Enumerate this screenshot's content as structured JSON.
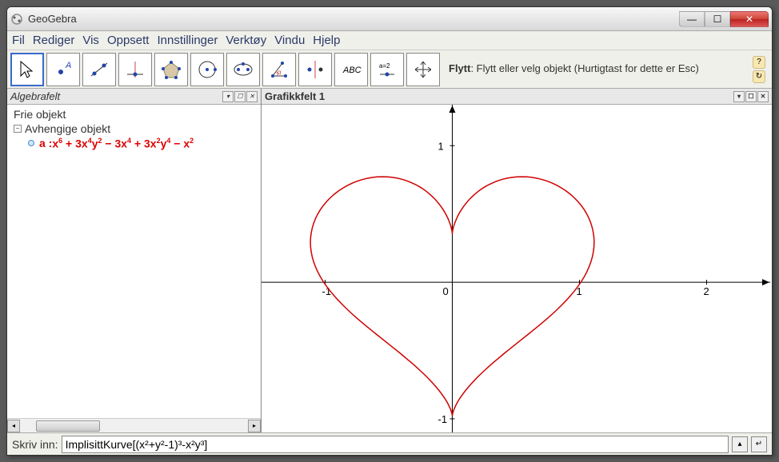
{
  "window_title": "GeoGebra",
  "menu": {
    "fil": "Fil",
    "rediger": "Rediger",
    "vis": "Vis",
    "oppsett": "Oppsett",
    "innstillinger": "Innstillinger",
    "verktoy": "Verktøy",
    "vindu": "Vindu",
    "hjelp": "Hjelp"
  },
  "toolbar_desc": {
    "title": "Flytt",
    "body": ": Flytt eller velg objekt (Hurtigtast for dette er Esc)"
  },
  "algebra": {
    "title": "Algebrafelt",
    "frie": "Frie objekt",
    "avh": "Avhengige objekt",
    "formula_prefix": "a : ",
    "formula_html": "x<sup>6</sup> + 3x<sup>4</sup>y<sup>2</sup> − 3x<sup>4</sup> + 3x<sup>2</sup>y<sup>4</sup> − x<sup>2</sup>"
  },
  "graphics": {
    "title": "Grafikkfelt 1",
    "xticks": [
      "-1",
      "0",
      "1",
      "2"
    ],
    "yticks": [
      "-1",
      "0",
      "1"
    ]
  },
  "input": {
    "label": "Skriv inn:",
    "value": "ImplisittKurve[(x²+y²-1)³-x²y³]"
  },
  "chart_data": {
    "type": "implicit_curve",
    "equation": "(x²+y²-1)³ - x²y³ = 0",
    "expanded": "x⁶ + 3x⁴y² − 3x⁴ + 3x²y⁴ − x² ...",
    "object_name": "a",
    "color": "#d00000",
    "x_range": [
      -1.5,
      2.5
    ],
    "y_range": [
      -1.1,
      1.3
    ],
    "x_ticks": [
      -1,
      0,
      1,
      2
    ],
    "y_ticks": [
      -1,
      0,
      1
    ],
    "description": "Heart-shaped curve symmetric about the y-axis, crossing x-axis near x≈±1, top cusp near (0,1), bottom tip at (0,-1)"
  }
}
